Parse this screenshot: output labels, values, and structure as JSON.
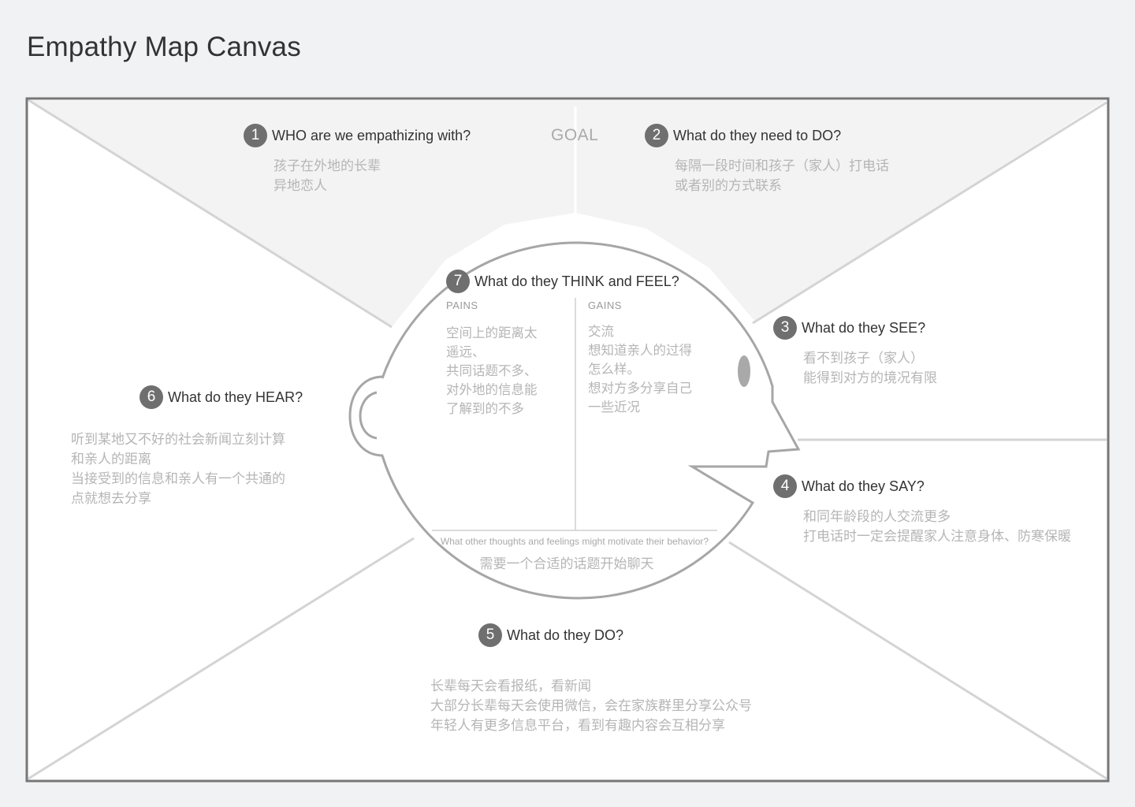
{
  "page": {
    "title": "Empathy Map Canvas"
  },
  "goal": {
    "label": "GOAL"
  },
  "who": {
    "number": "1",
    "question": "WHO are we empathizing with?",
    "answers": [
      "孩子在外地的长辈",
      "异地恋人"
    ]
  },
  "need_do": {
    "number": "2",
    "question": "What do they need to DO?",
    "answers": [
      "每隔一段时间和孩子（家人）打电话",
      "或者别的方式联系"
    ]
  },
  "see": {
    "number": "3",
    "question": "What do they SEE?",
    "answers": [
      "看不到孩子（家人）",
      "能得到对方的境况有限"
    ]
  },
  "say": {
    "number": "4",
    "question": "What do they SAY?",
    "answers": [
      "和同年龄段的人交流更多",
      "打电话时一定会提醒家人注意身体、防寒保暖"
    ]
  },
  "do": {
    "number": "5",
    "question": "What do they DO?",
    "answers": [
      "长辈每天会看报纸，看新闻",
      "大部分长辈每天会使用微信，会在家族群里分享公众号",
      "年轻人有更多信息平台，看到有趣内容会互相分享"
    ]
  },
  "hear": {
    "number": "6",
    "question": "What do they HEAR?",
    "answers": [
      "听到某地又不好的社会新闻立刻计算",
      "和亲人的距离",
      "当接受到的信息和亲人有一个共通的",
      "点就想去分享"
    ]
  },
  "think_feel": {
    "number": "7",
    "question": "What do they THINK and FEEL?",
    "pains": {
      "label": "PAINS",
      "answers": [
        "空间上的距离太",
        "遥远、",
        "共同话题不多、",
        "对外地的信息能",
        "了解到的不多"
      ]
    },
    "gains": {
      "label": "GAINS",
      "answers": [
        "交流",
        "想知道亲人的过得",
        "怎么样。",
        "想对方多分享自己",
        "一些近况"
      ]
    },
    "motivation_question": "What other thoughts and feelings might motivate their behavior?",
    "motivation_answer": "需要一个合适的话题开始聊天"
  }
}
